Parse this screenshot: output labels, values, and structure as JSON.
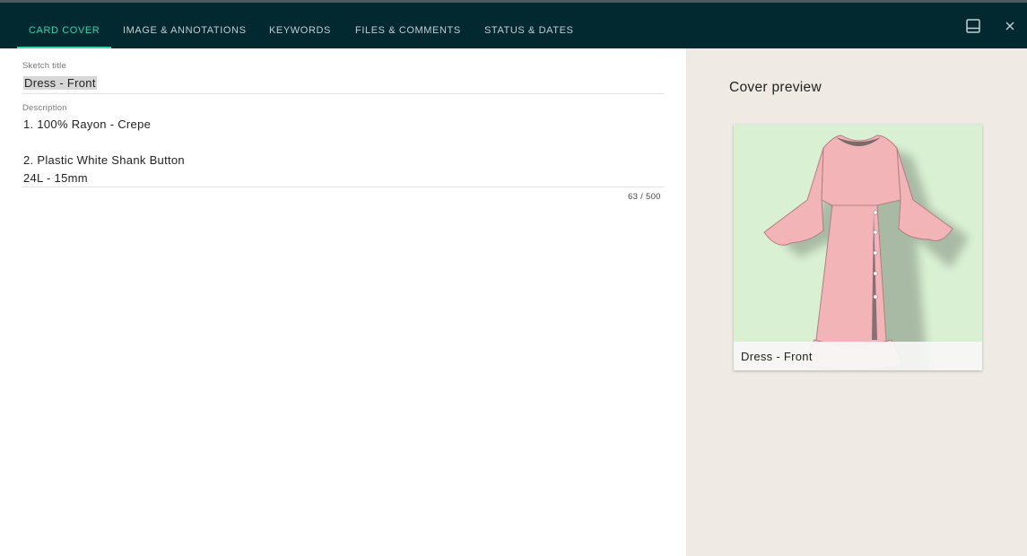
{
  "tabs": [
    {
      "label": "CARD COVER",
      "active": true
    },
    {
      "label": "IMAGE & ANNOTATIONS",
      "active": false
    },
    {
      "label": "KEYWORDS",
      "active": false
    },
    {
      "label": "FILES & COMMENTS",
      "active": false
    },
    {
      "label": "STATUS & DATES",
      "active": false
    }
  ],
  "toolbar": {
    "icons": [
      "panel-layout-icon",
      "close-icon"
    ],
    "close_glyph": "×"
  },
  "form": {
    "sketch_title": {
      "label": "Sketch title",
      "value": "Dress - Front"
    },
    "description": {
      "label": "Description",
      "lines": [
        "1. 100% Rayon - Crepe",
        "",
        "2. Plastic White Shank Button",
        "24L - 15mm"
      ],
      "counter": "63 / 500"
    }
  },
  "preview": {
    "title": "Cover preview",
    "caption": "Dress - Front"
  },
  "colors": {
    "tabbar": "#022830",
    "accent": "#33d3b0",
    "panel_bg": "#efebe4",
    "card_bg": "#d9f0d3",
    "dress": "#f2b4b7"
  }
}
